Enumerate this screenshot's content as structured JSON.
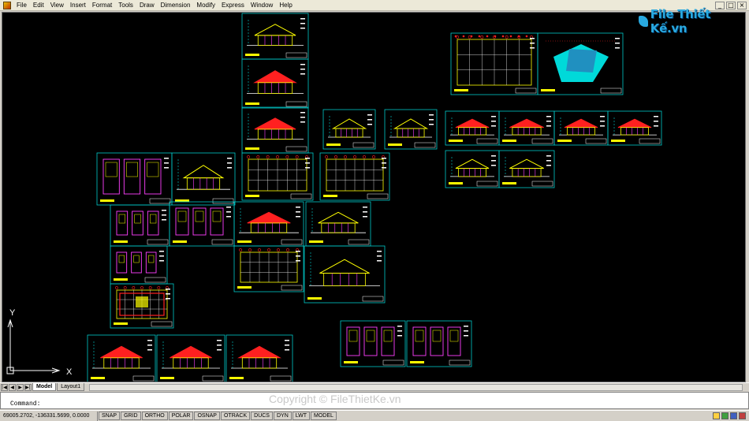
{
  "menubar": {
    "items": [
      "File",
      "Edit",
      "View",
      "Insert",
      "Format",
      "Tools",
      "Draw",
      "Dimension",
      "Modify",
      "Express",
      "Window",
      "Help"
    ],
    "app_icon": "autocad-app-icon",
    "controls": [
      "_",
      "□",
      "×"
    ]
  },
  "logo": {
    "text": "File Thiết Kế.vn",
    "icon": "file-logo-icon",
    "color": "#29a9e0"
  },
  "ucs": {
    "x_label": "X",
    "y_label": "Y"
  },
  "tabs": {
    "nav": [
      "|◀",
      "◀",
      "▶",
      "▶|"
    ],
    "items": [
      {
        "label": "Model",
        "active": true
      },
      {
        "label": "Layout1",
        "active": false
      }
    ]
  },
  "command": {
    "prompt": "Command:",
    "watermark": "Copyright © FileThietKe.vn"
  },
  "status": {
    "coordinates": "69005.2702, -136331.5699, 0.0000",
    "toggles": [
      "SNAP",
      "GRID",
      "ORTHO",
      "POLAR",
      "OSNAP",
      "OTRACK",
      "DUCS",
      "DYN",
      "LWT",
      "MODEL"
    ]
  },
  "colors": {
    "canvas": "#000000",
    "frame": "#00c8c8",
    "roof": "#ff2020",
    "drawing": "#ffff00",
    "accent_magenta": "#ff40ff",
    "accent_cyan": "#00ffff",
    "text": "#ffffff"
  }
}
